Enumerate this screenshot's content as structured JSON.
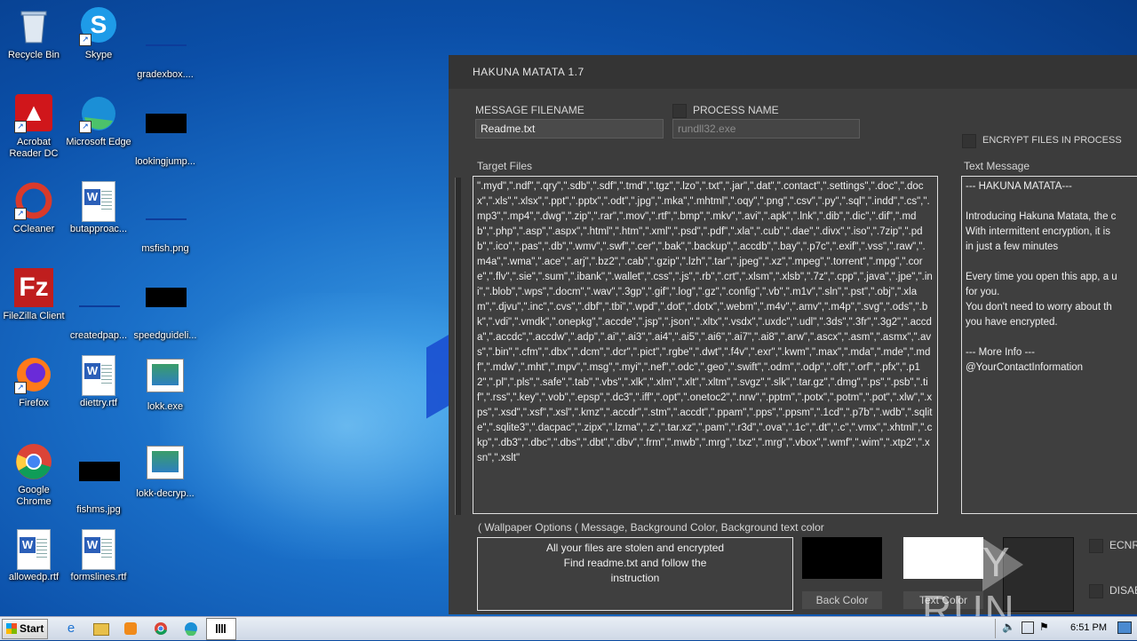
{
  "desktop": {
    "icons": [
      {
        "label": "Recycle Bin"
      },
      {
        "label": "Skype"
      },
      {
        "label": "gradexbox...."
      },
      {
        "label": "Acrobat Reader DC"
      },
      {
        "label": "Microsoft Edge"
      },
      {
        "label": "lookingjump..."
      },
      {
        "label": "CCleaner"
      },
      {
        "label": "butapproac..."
      },
      {
        "label": "msfish.png"
      },
      {
        "label": "FileZilla Client"
      },
      {
        "label": "createdpap..."
      },
      {
        "label": "speedguideli..."
      },
      {
        "label": "Firefox"
      },
      {
        "label": "diettry.rtf"
      },
      {
        "label": "lokk.exe"
      },
      {
        "label": "Google Chrome"
      },
      {
        "label": "fishms.jpg"
      },
      {
        "label": "lokk-decryp..."
      },
      {
        "label": "allowedp.rtf"
      },
      {
        "label": "formslines.rtf"
      }
    ]
  },
  "app": {
    "title": "HAKUNA MATATA 1.7",
    "message_filename_label": "MESSAGE FILENAME",
    "message_filename_value": "Readme.txt",
    "process_name_label": "PROCESS NAME",
    "process_name_value": "rundll32.exe",
    "encrypt_in_process_label": "ENCRYPT FILES IN PROCESS",
    "target_files_label": "Target Files",
    "target_files_value": "\".myd\",\".ndf\",\".qry\",\".sdb\",\".sdf\",\".tmd\",\".tgz\",\".lzo\",\".txt\",\".jar\",\".dat\",\".contact\",\".settings\",\".doc\",\".docx\",\".xls\",\".xlsx\",\".ppt\",\".pptx\",\".odt\",\".jpg\",\".mka\",\".mhtml\",\".oqy\",\".png\",\".csv\",\".py\",\".sql\",\".indd\",\".cs\",\".mp3\",\".mp4\",\".dwg\",\".zip\",\".rar\",\".mov\",\".rtf\",\".bmp\",\".mkv\",\".avi\",\".apk\",\".lnk\",\".dib\",\".dic\",\".dif\",\".mdb\",\".php\",\".asp\",\".aspx\",\".html\",\".htm\",\".xml\",\".psd\",\".pdf\",\".xla\",\".cub\",\".dae\",\".divx\",\".iso\",\".7zip\",\".pdb\",\".ico\",\".pas\",\".db\",\".wmv\",\".swf\",\".cer\",\".bak\",\".backup\",\".accdb\",\".bay\",\".p7c\",\".exif\",\".vss\",\".raw\",\".m4a\",\".wma\",\".ace\",\".arj\",\".bz2\",\".cab\",\".gzip\",\".lzh\",\".tar\",\".jpeg\",\".xz\",\".mpeg\",\".torrent\",\".mpg\",\".core\",\".flv\",\".sie\",\".sum\",\".ibank\",\".wallet\",\".css\",\".js\",\".rb\",\".crt\",\".xlsm\",\".xlsb\",\".7z\",\".cpp\",\".java\",\".jpe\",\".ini\",\".blob\",\".wps\",\".docm\",\".wav\",\".3gp\",\".gif\",\".log\",\".gz\",\".config\",\".vb\",\".m1v\",\".sln\",\".pst\",\".obj\",\".xlam\",\".djvu\",\".inc\",\".cvs\",\".dbf\",\".tbi\",\".wpd\",\".dot\",\".dotx\",\".webm\",\".m4v\",\".amv\",\".m4p\",\".svg\",\".ods\",\".bk\",\".vdi\",\".vmdk\",\".onepkg\",\".accde\",\".jsp\",\".json\",\".xltx\",\".vsdx\",\".uxdc\",\".udl\",\".3ds\",\".3fr\",\".3g2\",\".accda\",\".accdc\",\".accdw\",\".adp\",\".ai\",\".ai3\",\".ai4\",\".ai5\",\".ai6\",\".ai7\",\".ai8\",\".arw\",\".ascx\",\".asm\",\".asmx\",\".avs\",\".bin\",\".cfm\",\".dbx\",\".dcm\",\".dcr\",\".pict\",\".rgbe\",\".dwt\",\".f4v\",\".exr\",\".kwm\",\".max\",\".mda\",\".mde\",\".mdf\",\".mdw\",\".mht\",\".mpv\",\".msg\",\".myi\",\".nef\",\".odc\",\".geo\",\".swift\",\".odm\",\".odp\",\".oft\",\".orf\",\".pfx\",\".p12\",\".pl\",\".pls\",\".safe\",\".tab\",\".vbs\",\".xlk\",\".xlm\",\".xlt\",\".xltm\",\".svgz\",\".slk\",\".tar.gz\",\".dmg\",\".ps\",\".psb\",\".tif\",\".rss\",\".key\",\".vob\",\".epsp\",\".dc3\",\".iff\",\".opt\",\".onetoc2\",\".nrw\",\".pptm\",\".potx\",\".potm\",\".pot\",\".xlw\",\".xps\",\".xsd\",\".xsf\",\".xsl\",\".kmz\",\".accdr\",\".stm\",\".accdt\",\".ppam\",\".pps\",\".ppsm\",\".1cd\",\".p7b\",\".wdb\",\".sqlite\",\".sqlite3\",\".dacpac\",\".zipx\",\".lzma\",\".z\",\".tar.xz\",\".pam\",\".r3d\",\".ova\",\".1c\",\".dt\",\".c\",\".vmx\",\".xhtml\",\".ckp\",\".db3\",\".dbc\",\".dbs\",\".dbt\",\".dbv\",\".frm\",\".mwb\",\".mrg\",\".txz\",\".mrg\",\".vbox\",\".wmf\",\".wim\",\".xtp2\",\".xsn\",\".xslt\"",
    "text_message_label": "Text Message",
    "text_message_value": "--- HAKUNA MATATA---\n\nIntroducing Hakuna Matata, the c\nWith intermittent encryption, it is\nin just a few minutes\n\nEvery time you open this app, a u\nfor you.\nYou don't need to worry about th\nyou have encrypted.\n\n--- More Info ---\n@YourContactInformation",
    "wallpaper_options_label": "( Wallpaper Options ( Message, Background Color, Background text color",
    "wallpaper_message": "All your files are stolen and encrypted\nFind readme.txt and follow the\ninstruction",
    "back_color_label": "Back Color",
    "text_color_label": "Text Color",
    "right_option_1": "ECNR",
    "right_option_2": "DISAB",
    "colors": {
      "back": "#000000",
      "text": "#ffffff"
    }
  },
  "watermark": {
    "text_left": "ANY",
    "text_right": "RUN"
  },
  "taskbar": {
    "start_label": "Start",
    "clock": "6:51 PM",
    "pinned": [
      "ie-icon",
      "explorer-icon",
      "media-player-icon",
      "chrome-icon",
      "edge-icon",
      "app-icon"
    ]
  }
}
